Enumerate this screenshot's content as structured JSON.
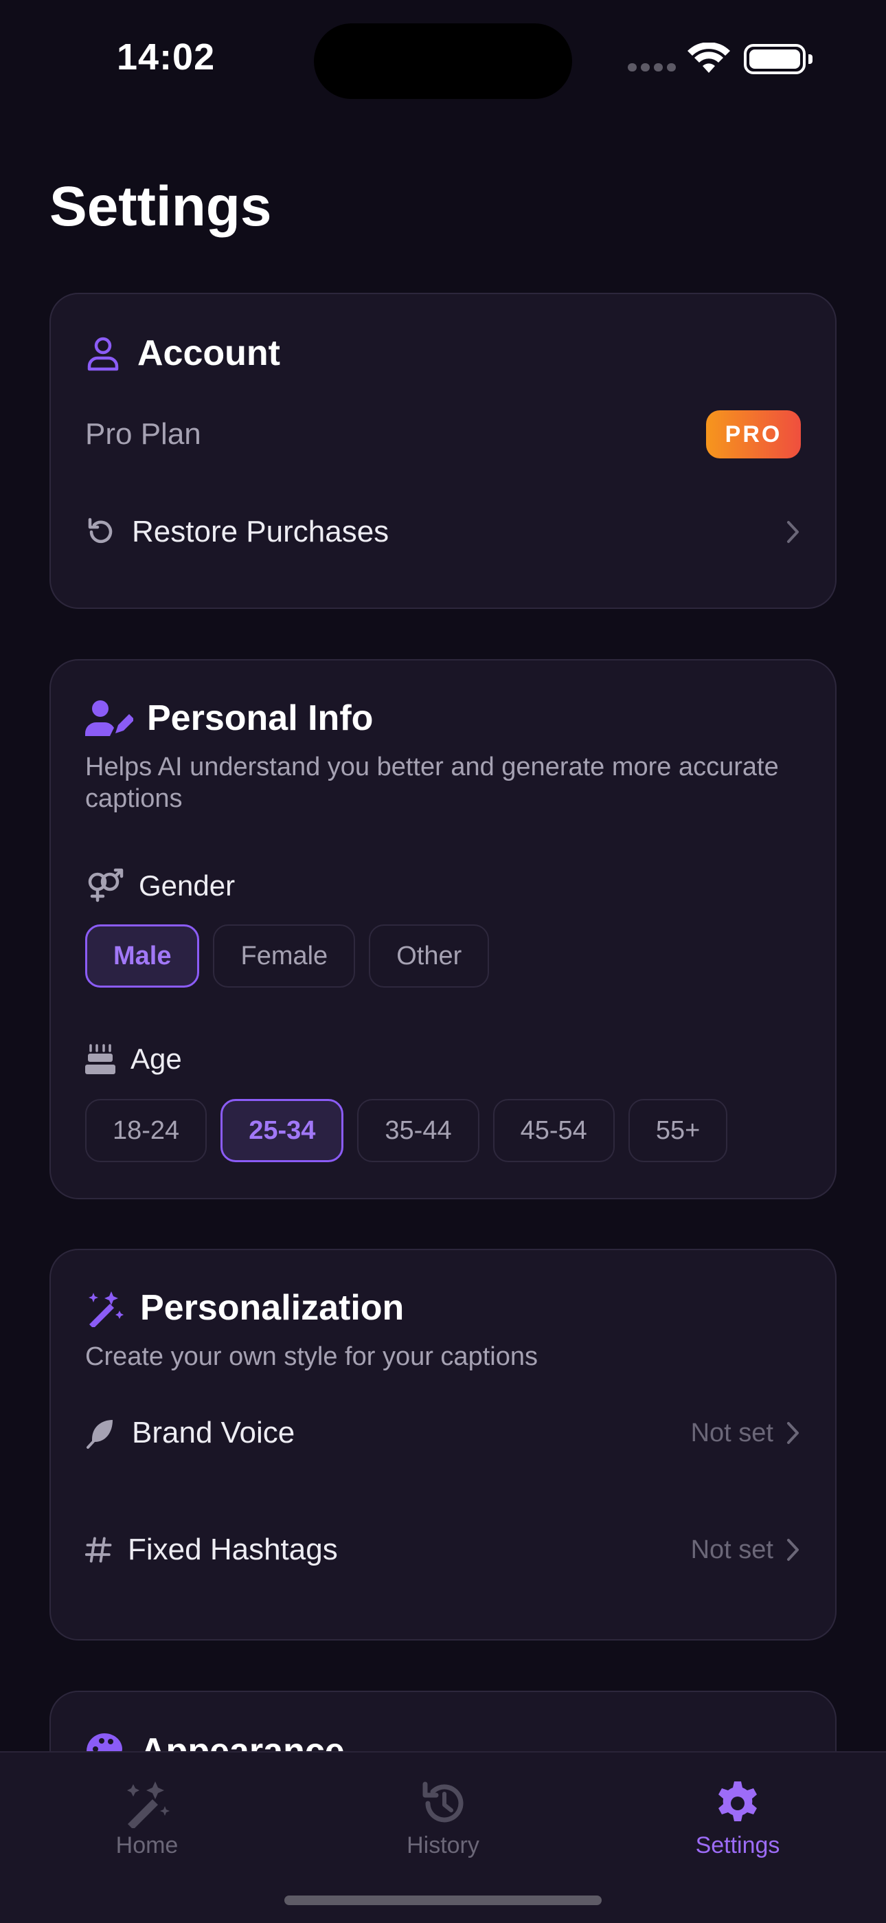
{
  "status_bar": {
    "time": "14:02"
  },
  "page": {
    "title": "Settings"
  },
  "account": {
    "title": "Account",
    "plan_label": "Pro Plan",
    "badge": "PRO",
    "restore_label": "Restore Purchases"
  },
  "personal_info": {
    "title": "Personal Info",
    "description": "Helps AI understand you better and generate more accurate captions",
    "gender_label": "Gender",
    "gender_options": [
      "Male",
      "Female",
      "Other"
    ],
    "gender_selected": "Male",
    "age_label": "Age",
    "age_options": [
      "18-24",
      "25-34",
      "35-44",
      "45-54",
      "55+"
    ],
    "age_selected": "25-34"
  },
  "personalization": {
    "title": "Personalization",
    "description": "Create your own style for your captions",
    "brand_voice_label": "Brand Voice",
    "brand_voice_value": "Not set",
    "fixed_hashtags_label": "Fixed Hashtags",
    "fixed_hashtags_value": "Not set"
  },
  "appearance": {
    "title": "Appearance"
  },
  "tab_bar": {
    "items": [
      {
        "label": "Home",
        "icon": "magic-wand-icon"
      },
      {
        "label": "History",
        "icon": "history-icon"
      },
      {
        "label": "Settings",
        "icon": "gear-icon"
      }
    ],
    "active": "Settings"
  },
  "colors": {
    "accent": "#8b5cf6",
    "background": "#0f0c18",
    "card": "#1a1526",
    "badge_start": "#f6961d",
    "badge_end": "#ef4f3e"
  }
}
